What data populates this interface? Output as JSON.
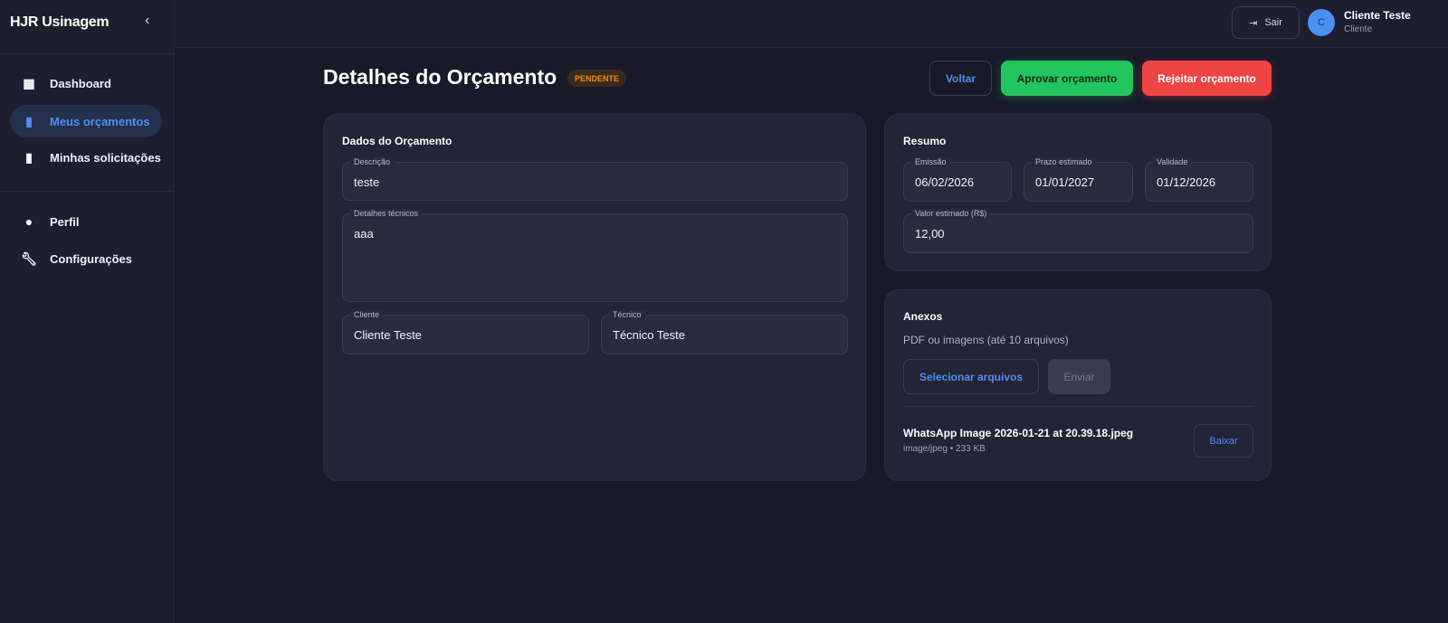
{
  "sidebar": {
    "brand": "HJR Usinagem",
    "items": [
      {
        "label": "Dashboard",
        "icon": "dashboard-icon"
      },
      {
        "label": "Meus orçamentos",
        "icon": "invoice-icon",
        "active": true
      },
      {
        "label": "Minhas solicitações",
        "icon": "request-icon"
      },
      {
        "label": "Perfil",
        "icon": "person-icon"
      },
      {
        "label": "Configurações",
        "icon": "wrench-icon"
      }
    ]
  },
  "topbar": {
    "logout": "Sair",
    "avatar_initial": "C",
    "user_name": "Cliente Teste",
    "user_role": "Cliente"
  },
  "page": {
    "title": "Detalhes do Orçamento",
    "status": "PENDENTE",
    "back": "Voltar",
    "approve": "Aprovar orçamento",
    "reject": "Rejeitar orçamento"
  },
  "dados": {
    "title": "Dados do Orçamento",
    "descricao_label": "Descrição",
    "descricao": "teste",
    "detalhes_label": "Detalhes técnicos",
    "detalhes": "aaa",
    "cliente_label": "Cliente",
    "cliente": "Cliente Teste",
    "tecnico_label": "Técnico",
    "tecnico": "Técnico Teste"
  },
  "resumo": {
    "title": "Resumo",
    "emissao_label": "Emissão",
    "emissao": "06/02/2026",
    "prazo_label": "Prazo estimado",
    "prazo": "01/01/2027",
    "validade_label": "Validade",
    "validade": "01/12/2026",
    "valor_label": "Valor estimado (R$)",
    "valor": "12,00"
  },
  "anexos": {
    "title": "Anexos",
    "hint": "PDF ou imagens (até 10 arquivos)",
    "select": "Selecionar arquivos",
    "send": "Enviar",
    "files": [
      {
        "name": "WhatsApp Image 2026-01-21 at 20.39.18.jpeg",
        "meta": "image/jpeg • 233 KB",
        "download": "Baixar"
      }
    ]
  },
  "colors": {
    "accent": "#4f8df0",
    "approve": "#22c55e",
    "reject": "#ef4444",
    "pending": "#f08a1c"
  }
}
